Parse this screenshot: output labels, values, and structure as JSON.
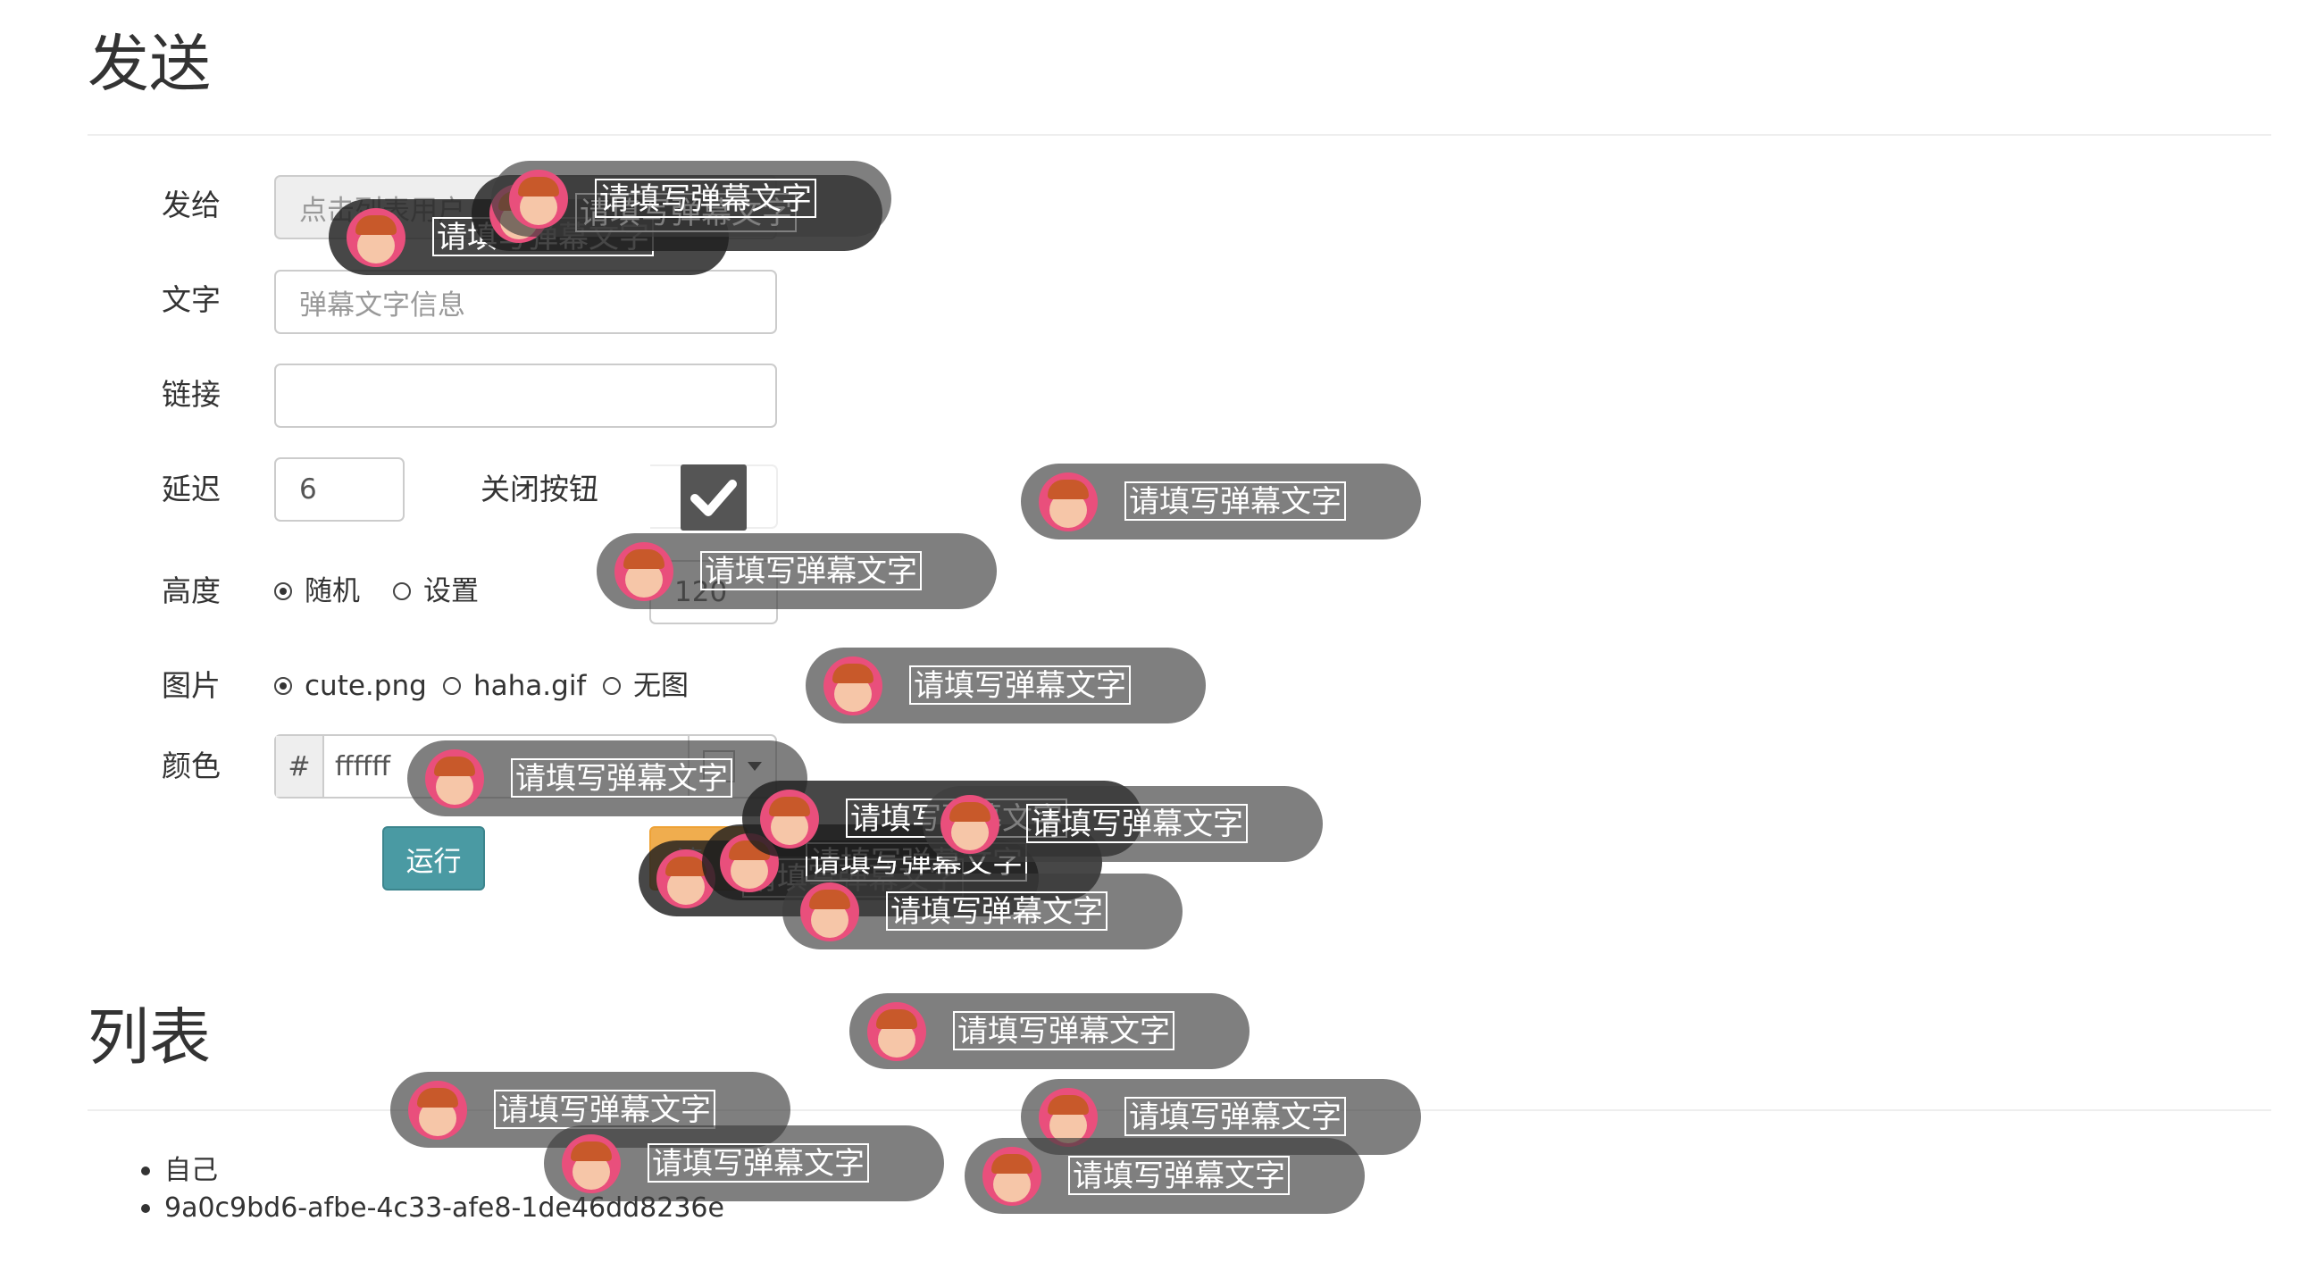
{
  "send_section": {
    "title": "发送",
    "labels": {
      "to": "发给",
      "text": "文字",
      "link": "链接",
      "delay": "延迟",
      "close_button": "关闭按钮",
      "height": "高度",
      "image": "图片",
      "color": "颜色"
    },
    "to_placeholder": "点击列表用户",
    "text_placeholder": "弹幕文字信息",
    "link_value": "",
    "delay_value": "6",
    "close_button_checked": true,
    "height_options": [
      "随机",
      "设置"
    ],
    "height_value": "120",
    "image_options": [
      "cute.png",
      "haha.gif",
      "无图"
    ],
    "color_prefix": "#",
    "color_value": "ffffff",
    "run_button": "运行",
    "clear_button": "清"
  },
  "list_section": {
    "title": "列表",
    "items": [
      "自己",
      "9a0c9bd6-afbe-4c33-afe8-1de46dd8236e"
    ]
  },
  "danmaku": {
    "text": "请填写弹幕文字",
    "icon": "girl-avatar-icon"
  },
  "colors": {
    "run_button": "#4a9aa3",
    "clear_button": "#f0ad4e",
    "danmaku_bg": "#505050"
  }
}
